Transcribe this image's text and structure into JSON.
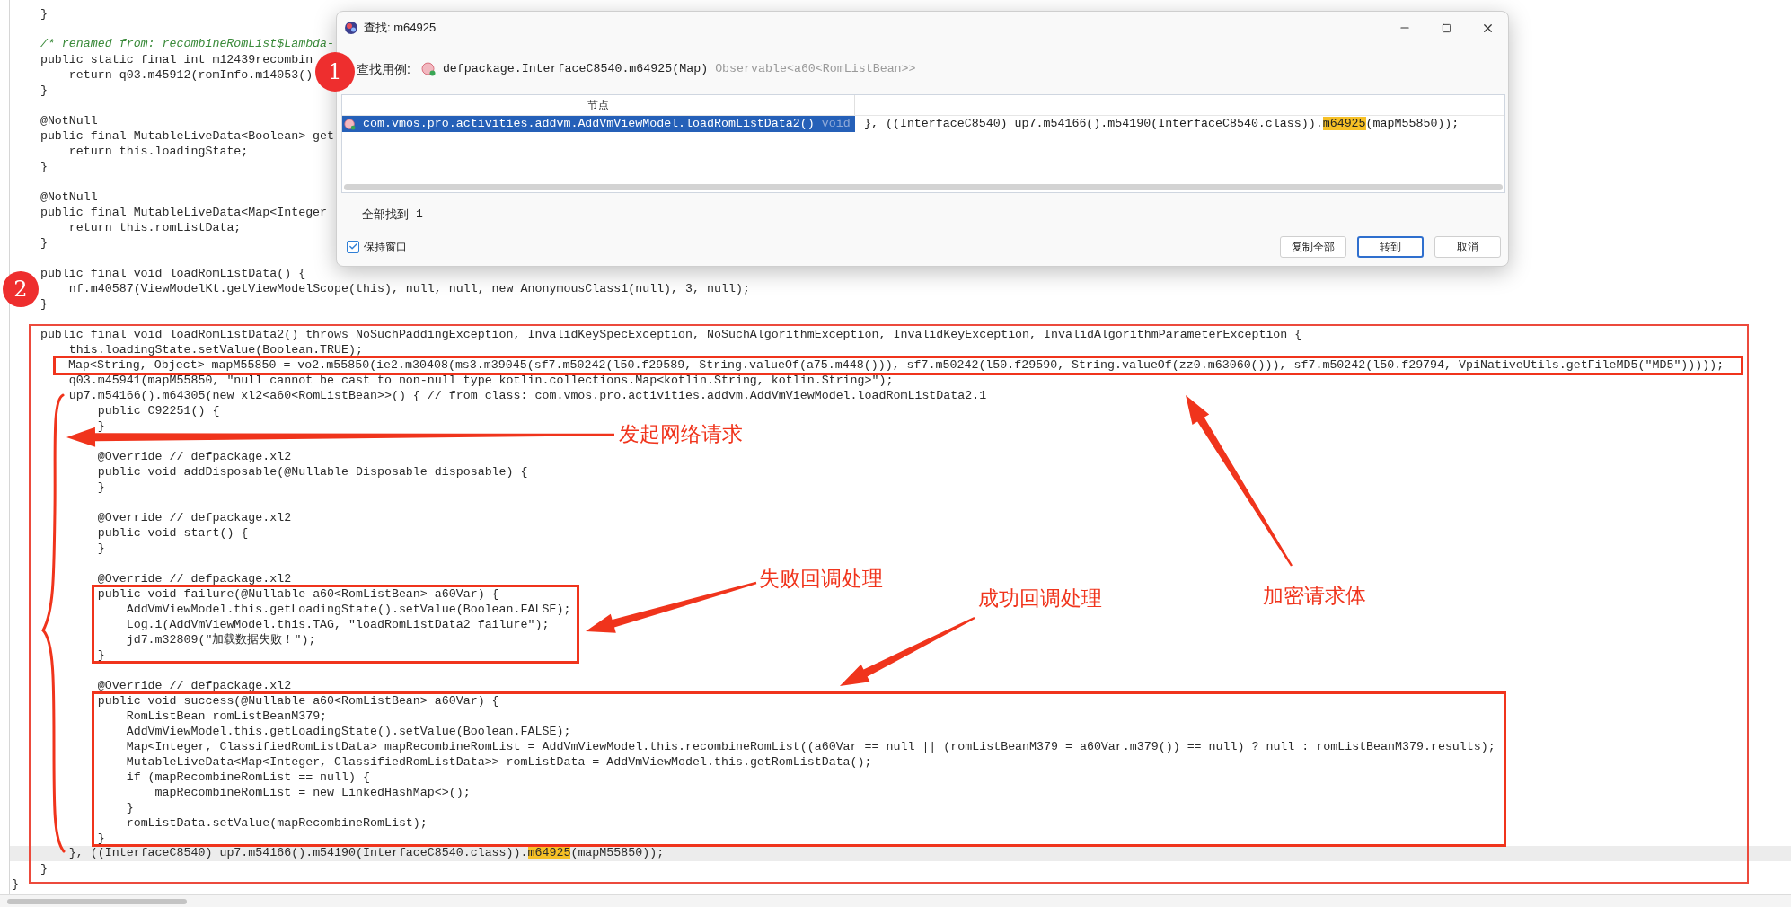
{
  "code_lines": [
    {
      "kind": "blank"
    },
    {
      "kind": "code",
      "text": "    }"
    },
    {
      "kind": "blank"
    },
    {
      "kind": "comment",
      "text": "    /* renamed from: recombineRomList$Lambda-"
    },
    {
      "kind": "code",
      "text": "    public static final int m12439recombin"
    },
    {
      "kind": "code",
      "text": "        return q03.m45912(romInfo.m14053()"
    },
    {
      "kind": "code",
      "text": "    }"
    },
    {
      "kind": "blank"
    },
    {
      "kind": "code",
      "text": "    @NotNull"
    },
    {
      "kind": "code",
      "text": "    public final MutableLiveData<Boolean> get"
    },
    {
      "kind": "code",
      "text": "        return this.loadingState;"
    },
    {
      "kind": "code",
      "text": "    }"
    },
    {
      "kind": "blank"
    },
    {
      "kind": "code",
      "text": "    @NotNull"
    },
    {
      "kind": "code",
      "text": "    public final MutableLiveData<Map<Integer"
    },
    {
      "kind": "code",
      "text": "        return this.romListData;"
    },
    {
      "kind": "code",
      "text": "    }"
    },
    {
      "kind": "blank"
    },
    {
      "kind": "code",
      "text": "    public final void loadRomListData() {"
    },
    {
      "kind": "code",
      "text": "        nf.m40587(ViewModelKt.getViewModelScope(this), null, null, new AnonymousClass1(null), 3, null);"
    },
    {
      "kind": "code",
      "text": "    }"
    },
    {
      "kind": "blank"
    },
    {
      "kind": "code",
      "text": "    public final void loadRomListData2() throws NoSuchPaddingException, InvalidKeySpecException, NoSuchAlgorithmException, InvalidKeyException, InvalidAlgorithmParameterException {"
    },
    {
      "kind": "code",
      "text": "        this.loadingState.setValue(Boolean.TRUE);"
    },
    {
      "kind": "framed",
      "text": "        Map<String, Object> mapM55850 = vo2.m55850(ie2.m30408(ms3.m39045(sf7.m50242(l50.f29589, String.valueOf(a75.m448())), sf7.m50242(l50.f29590, String.valueOf(zz0.m63060())), sf7.m50242(l50.f29794, VpiNativeUtils.getFileMD5(\"MD5\")))));"
    },
    {
      "kind": "code",
      "text": "        q03.m45941(mapM55850, \"null cannot be cast to non-null type kotlin.collections.Map<kotlin.String, kotlin.String>\");"
    },
    {
      "kind": "code",
      "text": "        up7.m54166().m64305(new xl2<a60<RomListBean>>() { // from class: com.vmos.pro.activities.addvm.AddVmViewModel.loadRomListData2.1"
    },
    {
      "kind": "code",
      "text": "            public C92251() {"
    },
    {
      "kind": "code",
      "text": "            }"
    },
    {
      "kind": "blank"
    },
    {
      "kind": "code",
      "text": "            @Override // defpackage.xl2"
    },
    {
      "kind": "code",
      "text": "            public void addDisposable(@Nullable Disposable disposable) {"
    },
    {
      "kind": "code",
      "text": "            }"
    },
    {
      "kind": "blank"
    },
    {
      "kind": "code",
      "text": "            @Override // defpackage.xl2"
    },
    {
      "kind": "code",
      "text": "            public void start() {"
    },
    {
      "kind": "code",
      "text": "            }"
    },
    {
      "kind": "blank"
    },
    {
      "kind": "code",
      "text": "            @Override // defpackage.xl2"
    },
    {
      "kind": "code",
      "text": "            public void failure(@Nullable a60<RomListBean> a60Var) {"
    },
    {
      "kind": "code",
      "text": "                AddVmViewModel.this.getLoadingState().setValue(Boolean.FALSE);"
    },
    {
      "kind": "code",
      "text": "                Log.i(AddVmViewModel.this.TAG, \"loadRomListData2 failure\");"
    },
    {
      "kind": "code",
      "text": "                jd7.m32809(\"加载数据失败！\");"
    },
    {
      "kind": "code",
      "text": "            }"
    },
    {
      "kind": "blank"
    },
    {
      "kind": "code",
      "text": "            @Override // defpackage.xl2"
    },
    {
      "kind": "code",
      "text": "            public void success(@Nullable a60<RomListBean> a60Var) {"
    },
    {
      "kind": "code",
      "text": "                RomListBean romListBeanM379;"
    },
    {
      "kind": "code",
      "text": "                AddVmViewModel.this.getLoadingState().setValue(Boolean.FALSE);"
    },
    {
      "kind": "code",
      "text": "                Map<Integer, ClassifiedRomListData> mapRecombineRomList = AddVmViewModel.this.recombineRomList((a60Var == null || (romListBeanM379 = a60Var.m379()) == null) ? null : romListBeanM379.results);"
    },
    {
      "kind": "code",
      "text": "                MutableLiveData<Map<Integer, ClassifiedRomListData>> romListData = AddVmViewModel.this.getRomListData();"
    },
    {
      "kind": "code",
      "text": "                if (mapRecombineRomList == null) {"
    },
    {
      "kind": "code",
      "text": "                    mapRecombineRomList = new LinkedHashMap<>();"
    },
    {
      "kind": "code",
      "text": "                }"
    },
    {
      "kind": "code",
      "text": "                romListData.setValue(mapRecombineRomList);"
    },
    {
      "kind": "code",
      "text": "            }"
    },
    {
      "kind": "current",
      "text": "        }, ((InterfaceC8540) up7.m54166().m54190(InterfaceC8540.class)).**m64925**(mapM55850));"
    },
    {
      "kind": "code",
      "text": "    }"
    },
    {
      "kind": "code",
      "text": "}"
    }
  ],
  "dialog": {
    "title": "查找: m64925",
    "query_label": "查找用例:",
    "query_method": "defpackage.InterfaceC8540.m64925(Map)",
    "query_type": "Observable<a60<RomListBean>>",
    "table": {
      "columns": [
        "节点"
      ],
      "rows": [
        {
          "node": "com.vmos.pro.activities.addvm.AddVmViewModel.loadRomListData2()",
          "return_type": "void",
          "code": "}, ((InterfaceC8540) up7.m54166().m54190(InterfaceC8540.class)).**m64925**(mapM55850));",
          "selected": true
        }
      ]
    },
    "found_label": "全部找到",
    "found_count": "1",
    "keep_window": {
      "label": "保持窗口",
      "checked": true
    },
    "buttons": [
      {
        "label": "复制全部",
        "kind": "normal"
      },
      {
        "label": "转到",
        "kind": "default"
      },
      {
        "label": "取消",
        "kind": "normal"
      }
    ]
  },
  "annotations": {
    "badges": [
      "1",
      "2"
    ],
    "labels": [
      "发起网络请求",
      "失败回调处理",
      "成功回调处理",
      "加密请求体"
    ]
  }
}
